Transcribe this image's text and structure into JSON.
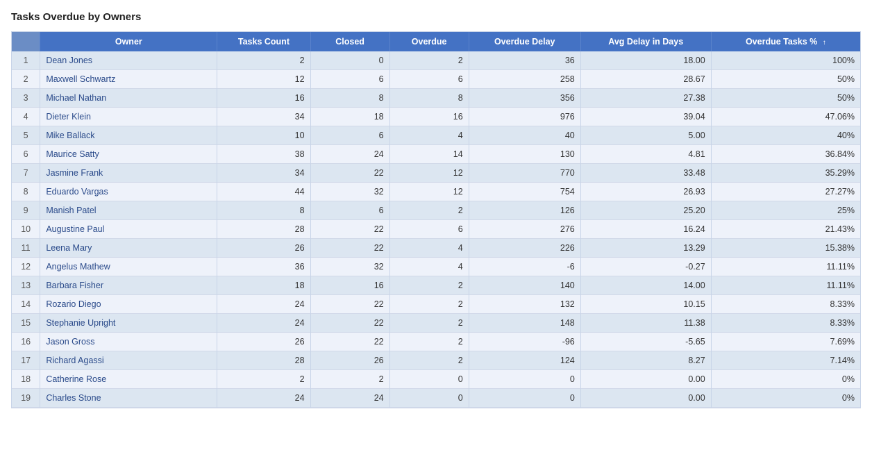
{
  "title": "Tasks Overdue by Owners",
  "table": {
    "headers": [
      {
        "label": "",
        "key": "index"
      },
      {
        "label": "Owner",
        "key": "owner"
      },
      {
        "label": "Tasks Count",
        "key": "tasksCount"
      },
      {
        "label": "Closed",
        "key": "closed"
      },
      {
        "label": "Overdue",
        "key": "overdue"
      },
      {
        "label": "Overdue Delay",
        "key": "overdueDelay"
      },
      {
        "label": "Avg Delay in Days",
        "key": "avgDelay"
      },
      {
        "label": "Overdue Tasks %",
        "key": "overdueTasksPct",
        "sorted": true
      }
    ],
    "rows": [
      {
        "index": 1,
        "owner": "Dean Jones",
        "tasksCount": 2,
        "closed": 0,
        "overdue": 2,
        "overdueDelay": 36,
        "avgDelay": "18.00",
        "overdueTasksPct": "100%"
      },
      {
        "index": 2,
        "owner": "Maxwell Schwartz",
        "tasksCount": 12,
        "closed": 6,
        "overdue": 6,
        "overdueDelay": 258,
        "avgDelay": "28.67",
        "overdueTasksPct": "50%"
      },
      {
        "index": 3,
        "owner": "Michael Nathan",
        "tasksCount": 16,
        "closed": 8,
        "overdue": 8,
        "overdueDelay": 356,
        "avgDelay": "27.38",
        "overdueTasksPct": "50%"
      },
      {
        "index": 4,
        "owner": "Dieter Klein",
        "tasksCount": 34,
        "closed": 18,
        "overdue": 16,
        "overdueDelay": 976,
        "avgDelay": "39.04",
        "overdueTasksPct": "47.06%"
      },
      {
        "index": 5,
        "owner": "Mike Ballack",
        "tasksCount": 10,
        "closed": 6,
        "overdue": 4,
        "overdueDelay": 40,
        "avgDelay": "5.00",
        "overdueTasksPct": "40%"
      },
      {
        "index": 6,
        "owner": "Maurice Satty",
        "tasksCount": 38,
        "closed": 24,
        "overdue": 14,
        "overdueDelay": 130,
        "avgDelay": "4.81",
        "overdueTasksPct": "36.84%"
      },
      {
        "index": 7,
        "owner": "Jasmine Frank",
        "tasksCount": 34,
        "closed": 22,
        "overdue": 12,
        "overdueDelay": 770,
        "avgDelay": "33.48",
        "overdueTasksPct": "35.29%"
      },
      {
        "index": 8,
        "owner": "Eduardo Vargas",
        "tasksCount": 44,
        "closed": 32,
        "overdue": 12,
        "overdueDelay": 754,
        "avgDelay": "26.93",
        "overdueTasksPct": "27.27%"
      },
      {
        "index": 9,
        "owner": "Manish Patel",
        "tasksCount": 8,
        "closed": 6,
        "overdue": 2,
        "overdueDelay": 126,
        "avgDelay": "25.20",
        "overdueTasksPct": "25%"
      },
      {
        "index": 10,
        "owner": "Augustine Paul",
        "tasksCount": 28,
        "closed": 22,
        "overdue": 6,
        "overdueDelay": 276,
        "avgDelay": "16.24",
        "overdueTasksPct": "21.43%"
      },
      {
        "index": 11,
        "owner": "Leena Mary",
        "tasksCount": 26,
        "closed": 22,
        "overdue": 4,
        "overdueDelay": 226,
        "avgDelay": "13.29",
        "overdueTasksPct": "15.38%"
      },
      {
        "index": 12,
        "owner": "Angelus Mathew",
        "tasksCount": 36,
        "closed": 32,
        "overdue": 4,
        "overdueDelay": -6,
        "avgDelay": "-0.27",
        "overdueTasksPct": "11.11%"
      },
      {
        "index": 13,
        "owner": "Barbara Fisher",
        "tasksCount": 18,
        "closed": 16,
        "overdue": 2,
        "overdueDelay": 140,
        "avgDelay": "14.00",
        "overdueTasksPct": "11.11%"
      },
      {
        "index": 14,
        "owner": "Rozario Diego",
        "tasksCount": 24,
        "closed": 22,
        "overdue": 2,
        "overdueDelay": 132,
        "avgDelay": "10.15",
        "overdueTasksPct": "8.33%"
      },
      {
        "index": 15,
        "owner": "Stephanie Upright",
        "tasksCount": 24,
        "closed": 22,
        "overdue": 2,
        "overdueDelay": 148,
        "avgDelay": "11.38",
        "overdueTasksPct": "8.33%"
      },
      {
        "index": 16,
        "owner": "Jason Gross",
        "tasksCount": 26,
        "closed": 22,
        "overdue": 2,
        "overdueDelay": -96,
        "avgDelay": "-5.65",
        "overdueTasksPct": "7.69%"
      },
      {
        "index": 17,
        "owner": "Richard Agassi",
        "tasksCount": 28,
        "closed": 26,
        "overdue": 2,
        "overdueDelay": 124,
        "avgDelay": "8.27",
        "overdueTasksPct": "7.14%"
      },
      {
        "index": 18,
        "owner": "Catherine Rose",
        "tasksCount": 2,
        "closed": 2,
        "overdue": 0,
        "overdueDelay": 0,
        "avgDelay": "0.00",
        "overdueTasksPct": "0%"
      },
      {
        "index": 19,
        "owner": "Charles Stone",
        "tasksCount": 24,
        "closed": 24,
        "overdue": 0,
        "overdueDelay": 0,
        "avgDelay": "0.00",
        "overdueTasksPct": "0%"
      }
    ]
  }
}
